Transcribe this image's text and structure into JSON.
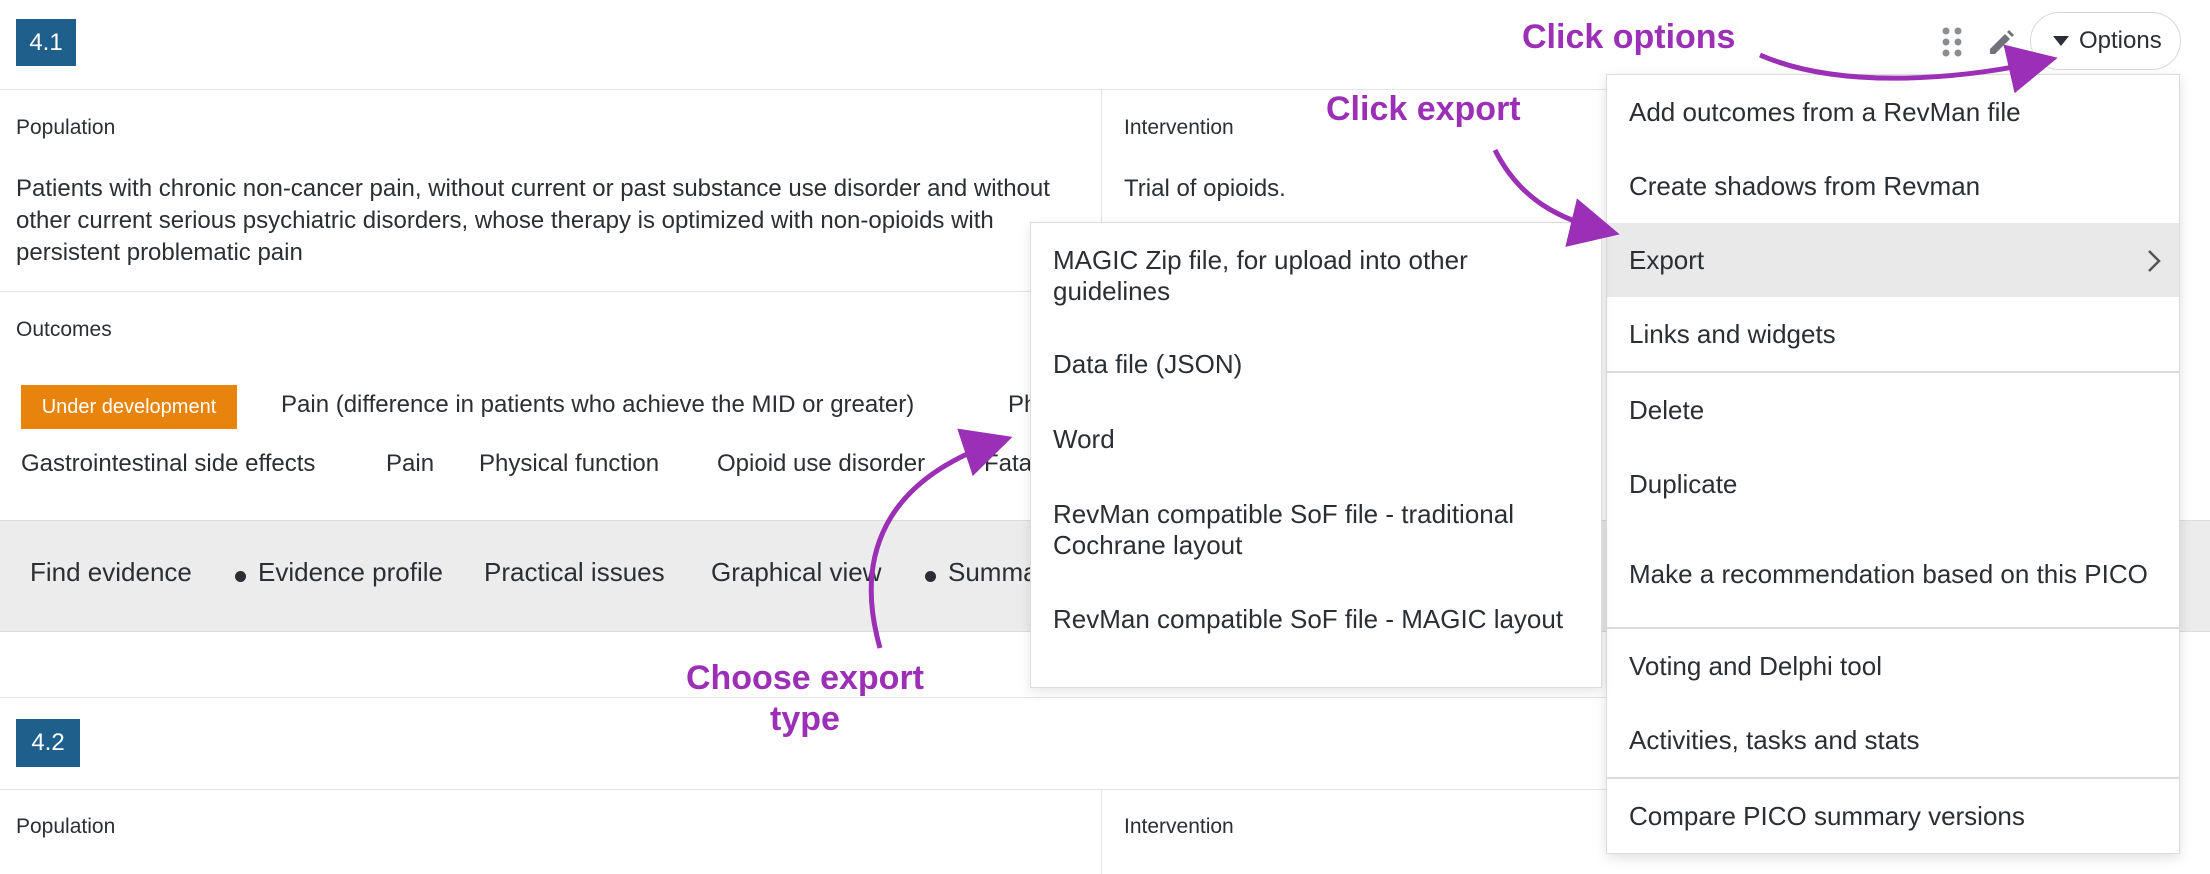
{
  "section1": {
    "number": "4.1",
    "population_label": "Population",
    "population_text": "Patients with chronic non-cancer pain, without current or past substance use disorder and without other current serious psychiatric disorders, whose therapy is optimized with non-opioids with persistent problematic pain",
    "intervention_label": "Intervention",
    "intervention_text": "Trial of opioids.",
    "outcomes_label": "Outcomes",
    "status_tag": "Under development",
    "outcomes_row1": [
      "Pain (difference in patients who achieve the MID or greater)",
      "Ph"
    ],
    "outcomes_row2": [
      "Gastrointestinal side effects",
      "Pain",
      "Physical function",
      "Opioid use disorder",
      "Fata"
    ]
  },
  "tabs": [
    {
      "label": "Find evidence",
      "dot": false
    },
    {
      "label": "Evidence profile",
      "dot": true
    },
    {
      "label": "Practical issues",
      "dot": false
    },
    {
      "label": "Graphical view",
      "dot": false
    },
    {
      "label": "Summa",
      "dot": true
    }
  ],
  "section2": {
    "number": "4.2",
    "population_label": "Population",
    "intervention_label": "Intervention"
  },
  "header": {
    "options_label": "Options",
    "icons": [
      "drag-handle-icon",
      "pencil-icon",
      "caret-down-icon"
    ]
  },
  "options_menu": [
    {
      "label": "Add outcomes from a RevMan file"
    },
    {
      "label": "Create shadows from Revman"
    },
    {
      "label": "Export",
      "submenu": true,
      "active": true
    },
    {
      "label": "Links and widgets"
    },
    {
      "label": "Delete"
    },
    {
      "label": "Duplicate"
    },
    {
      "label": "Make a recommendation based on this PICO"
    },
    {
      "label": "Voting and Delphi tool"
    },
    {
      "label": "Activities, tasks and stats"
    },
    {
      "label": "Compare PICO summary versions"
    }
  ],
  "export_submenu": [
    {
      "label": "MAGIC Zip file, for upload into other guidelines"
    },
    {
      "label": "Data file (JSON)"
    },
    {
      "label": "Word"
    },
    {
      "label": "RevMan compatible SoF file - traditional Cochrane layout"
    },
    {
      "label": "RevMan compatible SoF file - MAGIC layout"
    }
  ],
  "annotations": {
    "click_options": "Click options",
    "click_export": "Click export",
    "choose_export_line1": "Choose export",
    "choose_export_line2": "type"
  },
  "colors": {
    "annotation": "#9b2fb5",
    "badge": "#1f5f8b",
    "status_tag": "#e8840c"
  }
}
